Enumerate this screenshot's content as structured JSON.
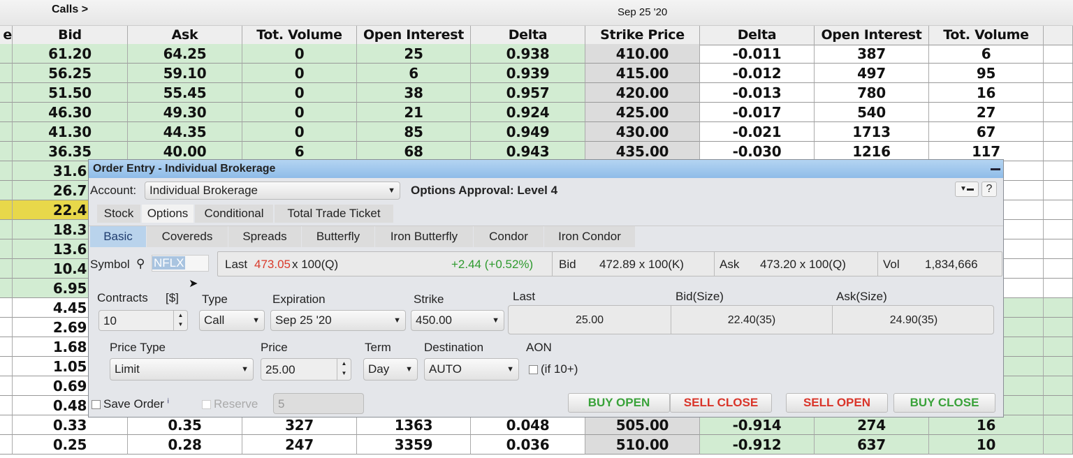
{
  "header": {
    "calls_label": "Calls >",
    "expiration": "Sep 25 '20"
  },
  "columns": [
    "e",
    "Bid",
    "Ask",
    "Tot. Volume",
    "Open Interest",
    "Delta",
    "Strike Price",
    "Delta",
    "Open Interest",
    "Tot. Volume",
    ""
  ],
  "rows": [
    {
      "strike": "410.00",
      "bid": "61.20",
      "ask": "64.25",
      "cvol": "0",
      "coi": "25",
      "cdelta": "0.938",
      "pdelta": "-0.011",
      "poi": "387",
      "pvol": "6",
      "call_itm": true,
      "put_itm": false
    },
    {
      "strike": "415.00",
      "bid": "56.25",
      "ask": "59.10",
      "cvol": "0",
      "coi": "6",
      "cdelta": "0.939",
      "pdelta": "-0.012",
      "poi": "497",
      "pvol": "95",
      "call_itm": true,
      "put_itm": false
    },
    {
      "strike": "420.00",
      "bid": "51.50",
      "ask": "55.45",
      "cvol": "0",
      "coi": "38",
      "cdelta": "0.957",
      "pdelta": "-0.013",
      "poi": "780",
      "pvol": "16",
      "call_itm": true,
      "put_itm": false
    },
    {
      "strike": "425.00",
      "bid": "46.30",
      "ask": "49.30",
      "cvol": "0",
      "coi": "21",
      "cdelta": "0.924",
      "pdelta": "-0.017",
      "poi": "540",
      "pvol": "27",
      "call_itm": true,
      "put_itm": false
    },
    {
      "strike": "430.00",
      "bid": "41.30",
      "ask": "44.35",
      "cvol": "0",
      "coi": "85",
      "cdelta": "0.949",
      "pdelta": "-0.021",
      "poi": "1713",
      "pvol": "67",
      "call_itm": true,
      "put_itm": false
    },
    {
      "strike": "435.00",
      "bid": "36.35",
      "ask": "40.00",
      "cvol": "6",
      "coi": "68",
      "cdelta": "0.943",
      "pdelta": "-0.030",
      "poi": "1216",
      "pvol": "117",
      "call_itm": true,
      "put_itm": false
    },
    {
      "bid": "31.6",
      "call_itm": true,
      "put_itm": false
    },
    {
      "bid": "26.7",
      "call_itm": true,
      "put_itm": false
    },
    {
      "bid": "22.4",
      "call_itm": true,
      "selected": true,
      "put_itm": false
    },
    {
      "bid": "18.3",
      "call_itm": true,
      "put_itm": false
    },
    {
      "bid": "13.6",
      "call_itm": true,
      "put_itm": false
    },
    {
      "bid": "10.4",
      "call_itm": true,
      "put_itm": false
    },
    {
      "bid": "6.95",
      "call_itm": true,
      "put_itm": false
    },
    {
      "bid": "4.45",
      "call_itm": false,
      "put_itm": true
    },
    {
      "bid": "2.69",
      "call_itm": false,
      "put_itm": true
    },
    {
      "bid": "1.68",
      "call_itm": false,
      "put_itm": true
    },
    {
      "bid": "1.05",
      "call_itm": false,
      "put_itm": true
    },
    {
      "bid": "0.69",
      "call_itm": false,
      "put_itm": true
    },
    {
      "bid": "0.48",
      "call_itm": false,
      "put_itm": true
    },
    {
      "strike": "505.00",
      "bid": "0.33",
      "ask": "0.35",
      "cvol": "327",
      "coi": "1363",
      "cdelta": "0.048",
      "pdelta": "-0.914",
      "poi": "274",
      "pvol": "16",
      "call_itm": false,
      "put_itm": true
    },
    {
      "strike": "510.00",
      "bid": "0.25",
      "ask": "0.28",
      "cvol": "247",
      "coi": "3359",
      "cdelta": "0.036",
      "pdelta": "-0.912",
      "poi": "637",
      "pvol": "10",
      "call_itm": false,
      "put_itm": true
    }
  ],
  "colors": {
    "itm_green": "#d2ecd2",
    "selected_yellow": "#e8d84a",
    "title_blue": "#9cc6ec",
    "change_green": "#2e9a2e",
    "last_red": "#d93a2a",
    "buy_green": "#3aa23a",
    "sell_red": "#d9352a"
  },
  "dialog": {
    "title": "Order Entry - Individual Brokerage",
    "account_label": "Account:",
    "account_value": "Individual Brokerage",
    "approval": "Options Approval: Level 4",
    "help": "?",
    "tabs": [
      "Stock",
      "Options",
      "Conditional",
      "Total Trade Ticket"
    ],
    "subtabs": [
      "Basic",
      "Covereds",
      "Spreads",
      "Butterfly",
      "Iron Butterfly",
      "Condor",
      "Iron Condor"
    ],
    "symbol_label": "Symbol",
    "symbol": "NFLX",
    "last_label": "Last",
    "last_price": "473.05",
    "last_size": "x 100(Q)",
    "change": "+2.44 (+0.52%)",
    "bid_label": "Bid",
    "bid_value": "472.89 x 100(K)",
    "ask_label": "Ask",
    "ask_value": "473.20 x 100(Q)",
    "vol_label": "Vol",
    "vol_value": "1,834,666",
    "contracts_label": "Contracts",
    "dollar_label": "[$]",
    "contracts": "10",
    "type_label": "Type",
    "type": "Call",
    "expiration_label": "Expiration",
    "expiration": "Sep 25 '20",
    "strike_label": "Strike",
    "strike": "450.00",
    "opt_last_label": "Last",
    "opt_last": "25.00",
    "opt_bid_label": "Bid(Size)",
    "opt_bid": "22.40(35)",
    "opt_ask_label": "Ask(Size)",
    "opt_ask": "24.90(35)",
    "price_type_label": "Price Type",
    "price_type": "Limit",
    "price_label": "Price",
    "price": "25.00",
    "term_label": "Term",
    "term": "Day",
    "destination_label": "Destination",
    "destination": "AUTO",
    "aon_label": "AON",
    "aon_text": "(if 10+)",
    "save_order": "Save Order",
    "info": "i",
    "reserve": "Reserve",
    "reserve_value": "5",
    "buttons": [
      "BUY OPEN",
      "SELL CLOSE",
      "SELL OPEN",
      "BUY CLOSE"
    ]
  }
}
